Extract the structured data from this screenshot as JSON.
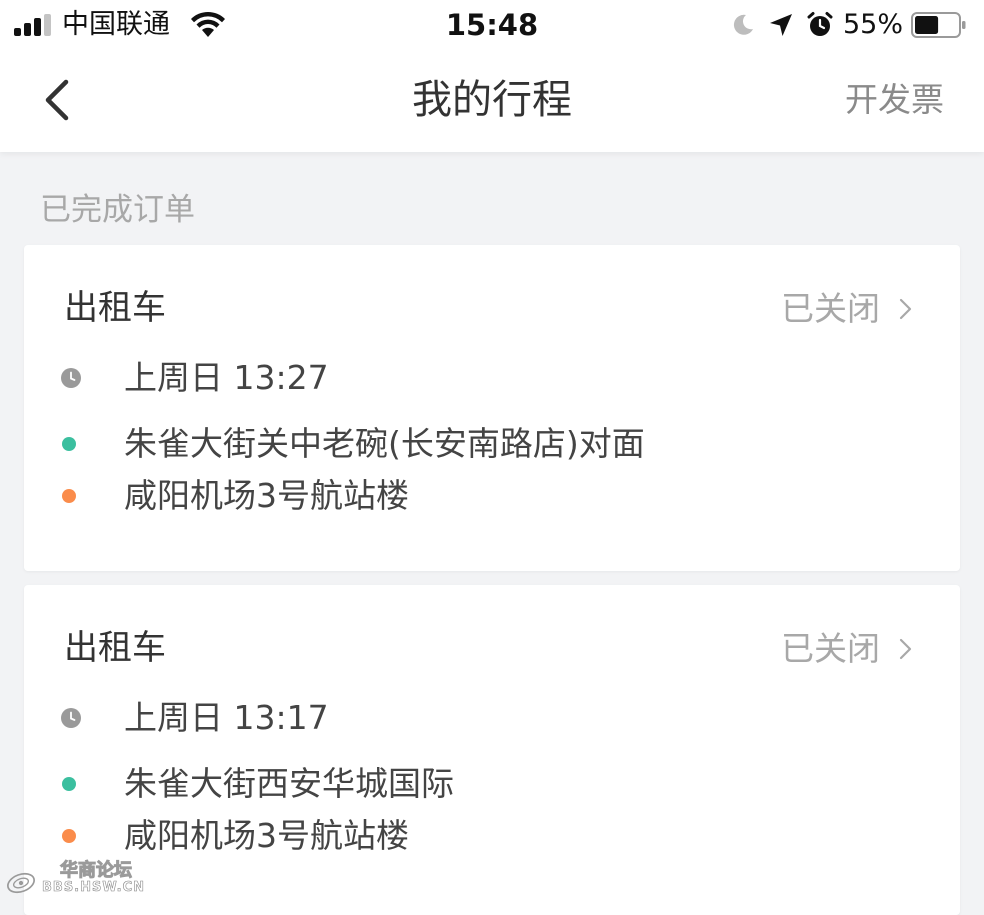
{
  "status_bar": {
    "carrier": "中国联通",
    "time": "15:48",
    "battery_percent": "55%",
    "icons": [
      "signal-icon",
      "wifi-icon",
      "moon-icon",
      "location-arrow-icon",
      "alarm-icon",
      "battery-icon"
    ],
    "signal_bars_filled": 3,
    "signal_bars_total": 4,
    "battery_level": 0.55
  },
  "nav": {
    "title": "我的行程",
    "back_icon": "chevron-left-icon",
    "invoice_label": "开发票"
  },
  "section": {
    "label": "已完成订单"
  },
  "orders": [
    {
      "type": "出租车",
      "status": "已关闭",
      "time": "上周日 13:27",
      "origin": "朱雀大街关中老碗(长安南路店)对面",
      "destination": "咸阳机场3号航站楼"
    },
    {
      "type": "出租车",
      "status": "已关闭",
      "time": "上周日 13:17",
      "origin": "朱雀大街西安华城国际",
      "destination": "咸阳机场3号航站楼"
    }
  ],
  "watermark": {
    "line1": "华商论坛",
    "line2": "BBS.HSW.CN"
  },
  "colors": {
    "origin_dot": "#3bbf9f",
    "destination_dot": "#fa8c4b",
    "accent_text": "#333333",
    "muted_text": "#a8a8a8",
    "page_background": "#f2f3f5"
  }
}
